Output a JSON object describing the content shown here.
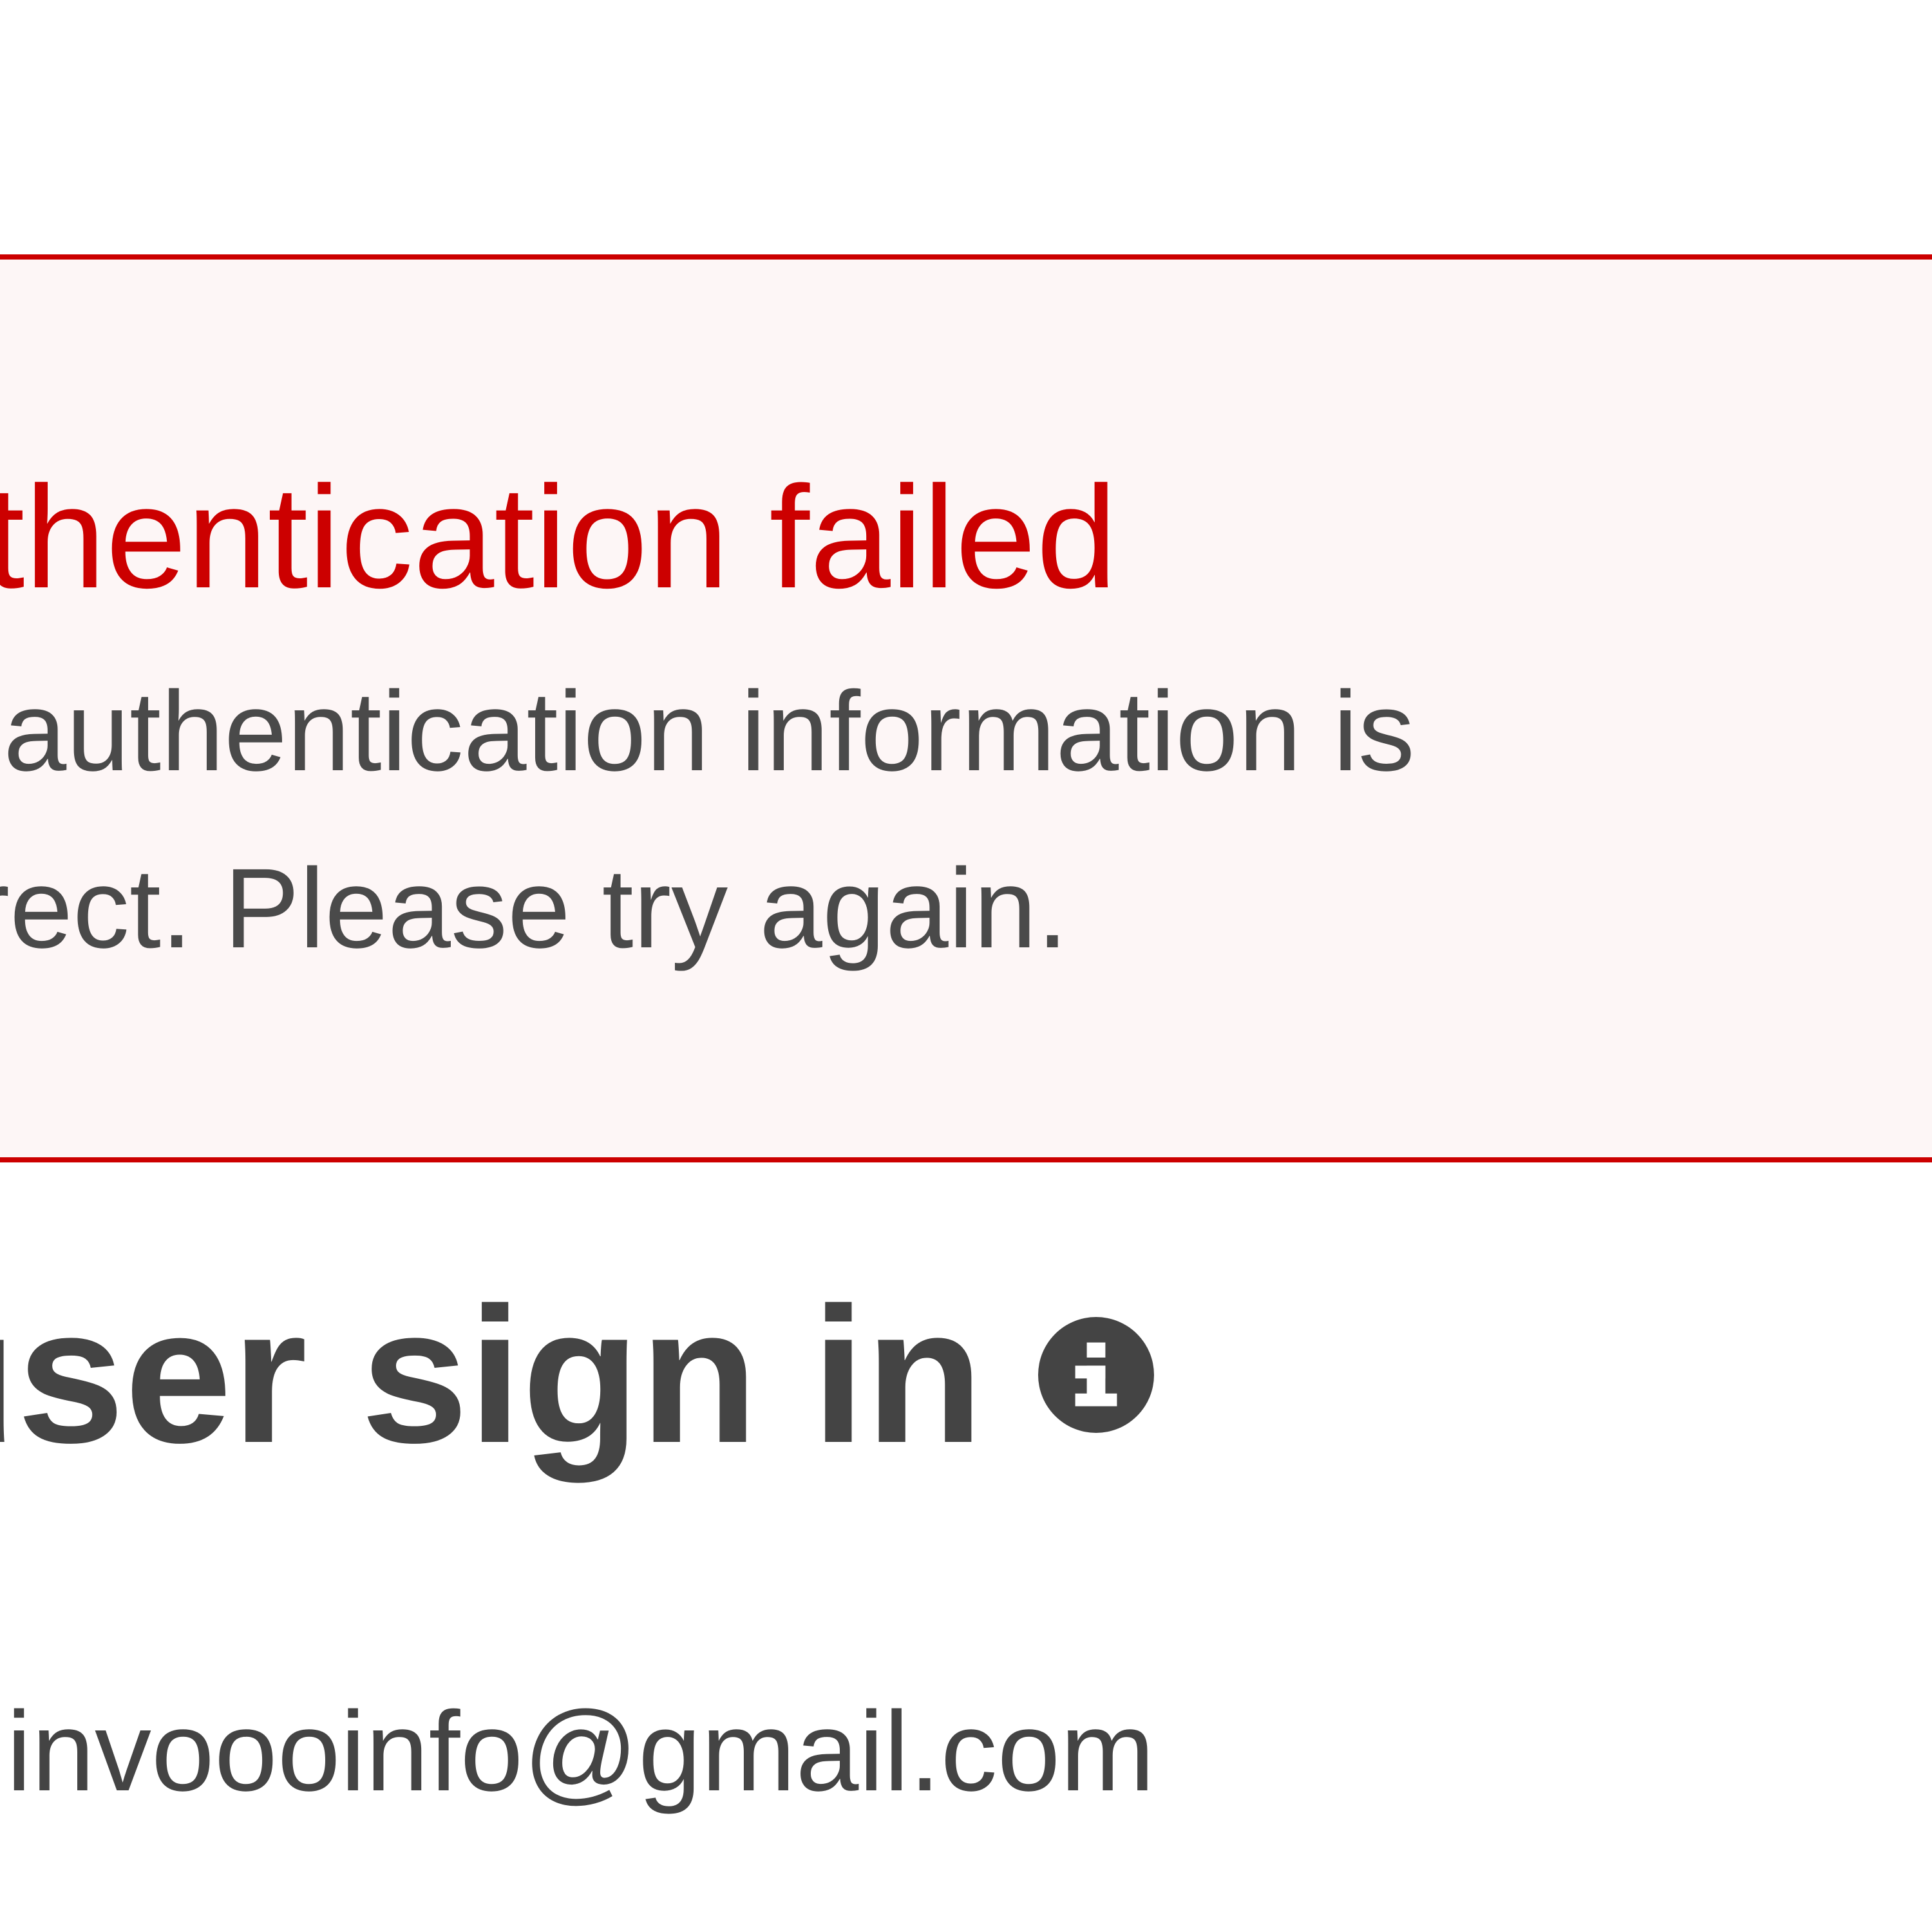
{
  "alert": {
    "title": "uthentication failed",
    "message_line1": "ur authentication information is",
    "message_line2": "orrect. Please try again."
  },
  "sign_in": {
    "heading": "t user sign in",
    "info_icon": "info-circle-icon",
    "account_email": "invoooinfo@gmail.com"
  },
  "colors": {
    "error_red": "#cc0000",
    "alert_background": "#fdf6f6",
    "text_dark": "#444444"
  }
}
